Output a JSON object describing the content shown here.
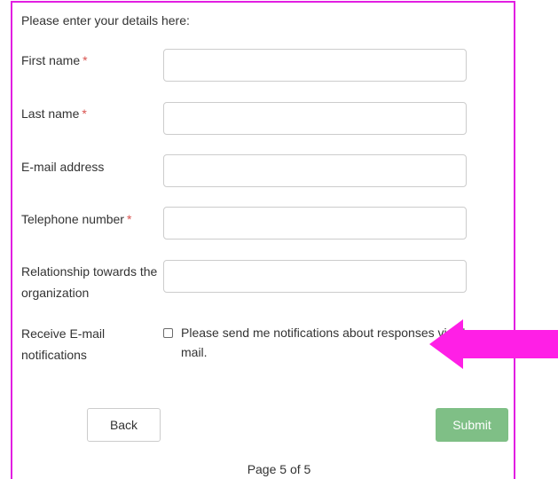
{
  "form": {
    "intro": "Please enter your details here:",
    "required_marker": "*",
    "fields": [
      {
        "label": "First name",
        "required": true,
        "value": "",
        "placeholder": ""
      },
      {
        "label": "Last name",
        "required": true,
        "value": "",
        "placeholder": ""
      },
      {
        "label": "E-mail address",
        "required": false,
        "value": "",
        "placeholder": ""
      },
      {
        "label": "Telephone number",
        "required": true,
        "value": "",
        "placeholder": ""
      },
      {
        "label": "Relationship towards the organization",
        "required": false,
        "value": "",
        "placeholder": ""
      }
    ],
    "notifications": {
      "label": "Receive E-mail notifications",
      "checkbox_text": "Please send me notifications about responses via E-mail.",
      "checked": false
    }
  },
  "buttons": {
    "back": "Back",
    "submit": "Submit"
  },
  "pagination": {
    "text": "Page 5 of 5"
  },
  "colors": {
    "frame_border": "#e21ee2",
    "arrow": "#ff1fe6",
    "required": "#d9534f",
    "submit_bg": "#7fbf86"
  },
  "icons": {
    "callout_arrow": "left-arrow-icon"
  }
}
